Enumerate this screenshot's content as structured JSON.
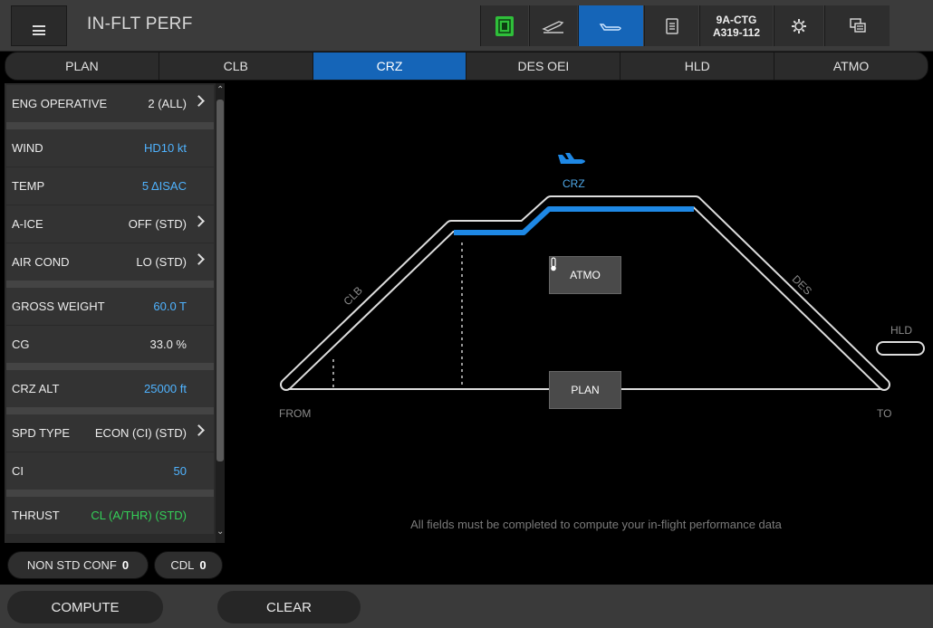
{
  "header": {
    "title": "IN-FLT PERF",
    "registration": "9A-CTG",
    "aircraft": "A319-112"
  },
  "tabs": [
    {
      "label": "PLAN",
      "active": false
    },
    {
      "label": "CLB",
      "active": false
    },
    {
      "label": "CRZ",
      "active": true
    },
    {
      "label": "DES OEI",
      "active": false
    },
    {
      "label": "HLD",
      "active": false
    },
    {
      "label": "ATMO",
      "active": false
    }
  ],
  "fields": {
    "eng_operative": {
      "label": "ENG OPERATIVE",
      "value": "2 (ALL)"
    },
    "wind": {
      "label": "WIND",
      "value": "HD10 kt"
    },
    "temp": {
      "label": "TEMP",
      "value": "5 ΔISAC"
    },
    "a_ice": {
      "label": "A-ICE",
      "value": "OFF (STD)"
    },
    "air_cond": {
      "label": "AIR COND",
      "value": "LO (STD)"
    },
    "gross_weight": {
      "label": "GROSS WEIGHT",
      "value": "60.0 T"
    },
    "cg": {
      "label": "CG",
      "value": "33.0 %"
    },
    "crz_alt": {
      "label": "CRZ ALT",
      "value": "25000 ft"
    },
    "spd_type": {
      "label": "SPD TYPE",
      "value": "ECON (CI) (STD)"
    },
    "ci": {
      "label": "CI",
      "value": "50"
    },
    "thrust": {
      "label": "THRUST",
      "value": "CL (A/THR) (STD)"
    }
  },
  "pills": {
    "non_std_conf": {
      "label": "NON STD CONF",
      "count": "0"
    },
    "cdl": {
      "label": "CDL",
      "count": "0"
    }
  },
  "diagram": {
    "crz_label": "CRZ",
    "clb_label": "CLB",
    "des_label": "DES",
    "from_label": "FROM",
    "to_label": "TO",
    "hld_label": "HLD",
    "atmo_button": "ATMO",
    "plan_button": "PLAN",
    "notice": "All fields must be completed to compute your in-flight performance data"
  },
  "actions": {
    "compute": "COMPUTE",
    "clear": "CLEAR"
  },
  "colors": {
    "accent": "#1565b8",
    "value_blue": "#4fb3ff",
    "value_green": "#34d058"
  }
}
